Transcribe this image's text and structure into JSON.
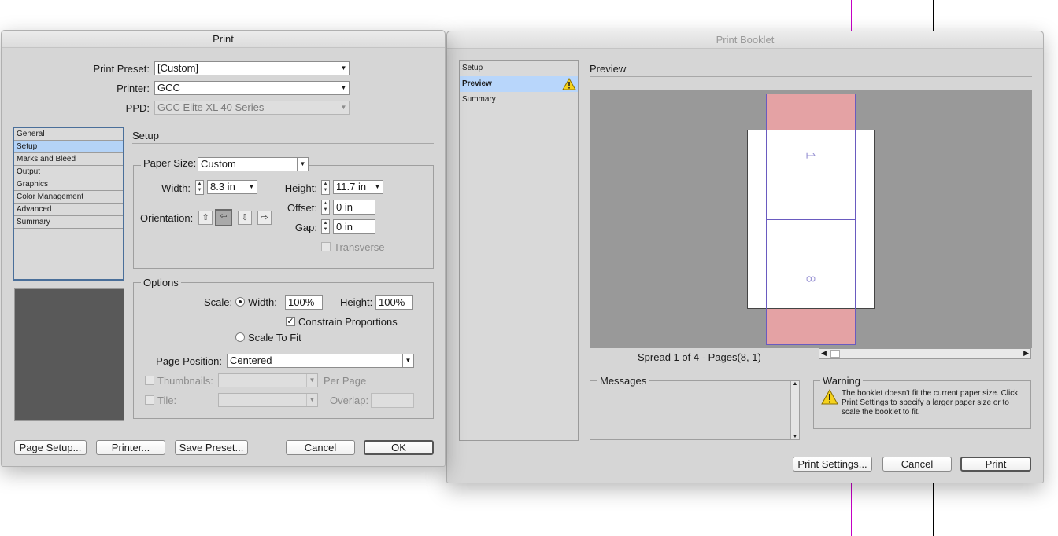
{
  "print_dialog": {
    "title": "Print",
    "print_preset_label": "Print Preset:",
    "print_preset_value": "[Custom]",
    "printer_label": "Printer:",
    "printer_value": "GCC",
    "ppd_label": "PPD:",
    "ppd_value": "GCC Elite XL 40 Series",
    "sidebar": [
      "General",
      "Setup",
      "Marks and Bleed",
      "Output",
      "Graphics",
      "Color Management",
      "Advanced",
      "Summary"
    ],
    "sidebar_selected": "Setup",
    "section_title": "Setup",
    "paper_size_label": "Paper Size:",
    "paper_size_value": "Custom",
    "width_label": "Width:",
    "width_value": "8.3 in",
    "height_label": "Height:",
    "height_value": "11.7 in",
    "orientation_label": "Orientation:",
    "offset_label": "Offset:",
    "offset_value": "0 in",
    "gap_label": "Gap:",
    "gap_value": "0 in",
    "transverse_label": "Transverse",
    "options_legend": "Options",
    "scale_label": "Scale:",
    "scale_width_label": "Width:",
    "scale_width_value": "100%",
    "scale_height_label": "Height:",
    "scale_height_value": "100%",
    "constrain_label": "Constrain Proportions",
    "scale_to_fit_label": "Scale To Fit",
    "page_position_label": "Page Position:",
    "page_position_value": "Centered",
    "thumbnails_label": "Thumbnails:",
    "per_page_label": "Per Page",
    "tile_label": "Tile:",
    "overlap_label": "Overlap:",
    "buttons": {
      "page_setup": "Page Setup...",
      "printer": "Printer...",
      "save_preset": "Save Preset...",
      "cancel": "Cancel",
      "ok": "OK"
    }
  },
  "booklet_dialog": {
    "title": "Print Booklet",
    "sidebar": [
      "Setup",
      "Preview",
      "Summary"
    ],
    "sidebar_selected": "Preview",
    "section_title": "Preview",
    "page_top_label": "1",
    "page_bottom_label": "8",
    "spread_text": "Spread 1 of 4 - Pages(8, 1)",
    "messages_legend": "Messages",
    "warning_legend": "Warning",
    "warning_text": "The booklet doesn't fit the current paper size. Click Print Settings to specify a larger paper size or to scale the booklet to fit.",
    "buttons": {
      "print_settings": "Print Settings...",
      "cancel": "Cancel",
      "print": "Print"
    }
  },
  "colors": {
    "guide_magenta": "#c400c4",
    "guide_black": "#000000",
    "bleed_pink": "#e4a2a4",
    "page_frame_purple": "#6a5bc0",
    "preview_bg": "#999999",
    "selection_blue": "#b4d3f7"
  }
}
